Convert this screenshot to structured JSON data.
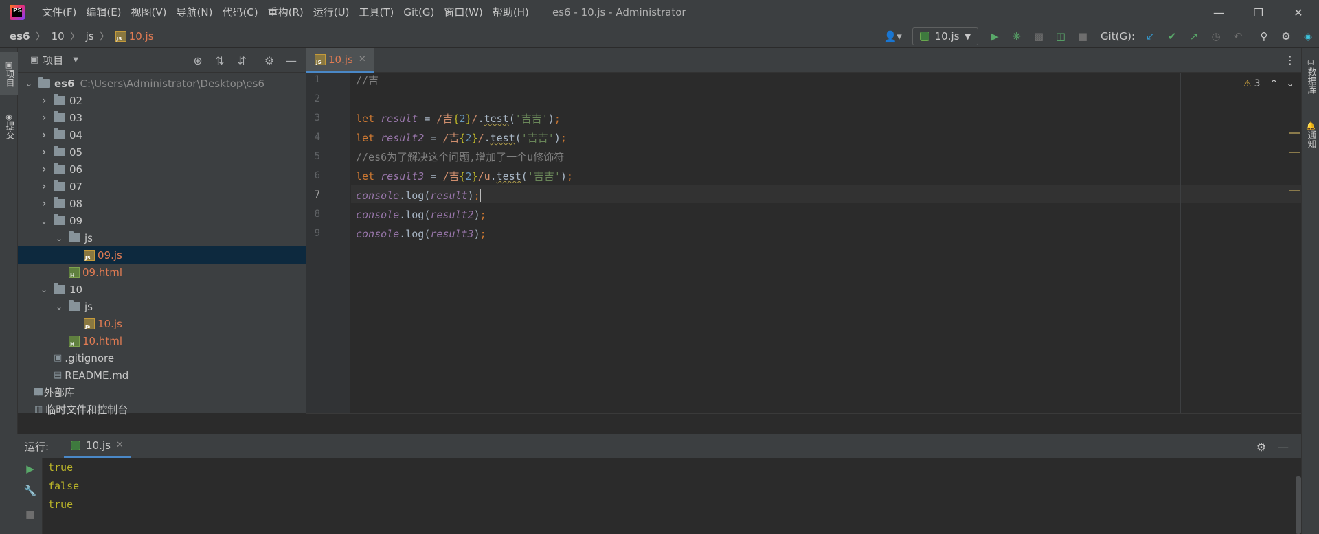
{
  "title_bar": {
    "menu": [
      "文件(F)",
      "编辑(E)",
      "视图(V)",
      "导航(N)",
      "代码(C)",
      "重构(R)",
      "运行(U)",
      "工具(T)",
      "Git(G)",
      "窗口(W)",
      "帮助(H)"
    ],
    "window_title": "es6 - 10.js - Administrator"
  },
  "breadcrumb": [
    "es6",
    "10",
    "js",
    "10.js"
  ],
  "toolbar": {
    "run_config": "10.js",
    "git_label": "Git(G):"
  },
  "left_strip": {
    "project_tab": "项目",
    "commit_tab": "提交"
  },
  "right_strip": {
    "database_tab": "数据库",
    "notifications_tab": "通知"
  },
  "project_panel": {
    "title": "项目",
    "tree": [
      {
        "label": "es6",
        "hint": "C:\\Users\\Administrator\\Desktop\\es6",
        "level": 0,
        "type": "folder",
        "expanded": true
      },
      {
        "label": "02",
        "level": 1,
        "type": "folder",
        "expanded": false
      },
      {
        "label": "03",
        "level": 1,
        "type": "folder",
        "expanded": false
      },
      {
        "label": "04",
        "level": 1,
        "type": "folder",
        "expanded": false
      },
      {
        "label": "05",
        "level": 1,
        "type": "folder",
        "expanded": false
      },
      {
        "label": "06",
        "level": 1,
        "type": "folder",
        "expanded": false
      },
      {
        "label": "07",
        "level": 1,
        "type": "folder",
        "expanded": false
      },
      {
        "label": "08",
        "level": 1,
        "type": "folder",
        "expanded": false
      },
      {
        "label": "09",
        "level": 1,
        "type": "folder",
        "expanded": true
      },
      {
        "label": "js",
        "level": 2,
        "type": "folder",
        "expanded": true
      },
      {
        "label": "09.js",
        "level": 3,
        "type": "js",
        "selected": true
      },
      {
        "label": "09.html",
        "level": 2,
        "type": "html"
      },
      {
        "label": "10",
        "level": 1,
        "type": "folder",
        "expanded": true
      },
      {
        "label": "js",
        "level": 2,
        "type": "folder",
        "expanded": true
      },
      {
        "label": "10.js",
        "level": 3,
        "type": "js"
      },
      {
        "label": "10.html",
        "level": 2,
        "type": "html"
      },
      {
        "label": ".gitignore",
        "level": 1,
        "type": "gitignore"
      },
      {
        "label": "README.md",
        "level": 1,
        "type": "md"
      },
      {
        "label": "外部库",
        "level": 0,
        "type": "library"
      },
      {
        "label": "临时文件和控制台",
        "level": 0,
        "type": "scratch"
      }
    ]
  },
  "editor": {
    "tab_label": "10.js",
    "warning_count": "3",
    "current_line": 7,
    "lines": [
      "//吉",
      "",
      "let result = /吉{2}/.test('吉吉');",
      "let result2 = /吉{2}/.test('吉吉');",
      "//es6为了解决这个问题,增加了一个u修饰符",
      "let result3 = /吉{2}/u.test('吉吉');",
      "console.log(result);",
      "console.log(result2);",
      "console.log(result3);"
    ]
  },
  "run_panel": {
    "label": "运行:",
    "tab_label": "10.js",
    "output": [
      "true",
      "false",
      "true"
    ]
  },
  "colors": {
    "keyword": "#cc7832",
    "variable": "#9876aa",
    "string": "#6a8759",
    "comment": "#808080",
    "console_output": "#bbb529",
    "modified_file": "#e07b53",
    "accent": "#4a88c7"
  }
}
